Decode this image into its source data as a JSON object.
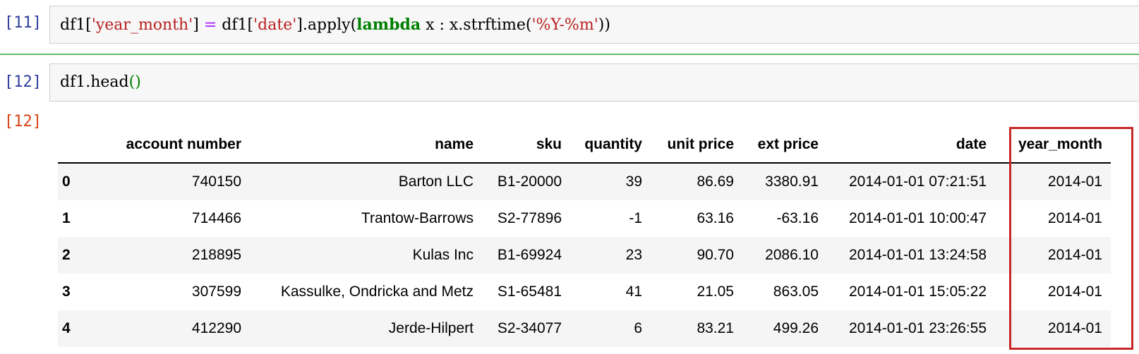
{
  "cells": [
    {
      "prompt": "[11]",
      "code": {
        "t1": "df1[",
        "s1": "'year_month'",
        "t2": "] ",
        "op": "=",
        "t3": " df1[",
        "s2": "'date'",
        "t4": "].apply(",
        "kw": "lambda",
        "t5": " x : x.strftime(",
        "s3": "'%Y-%m'",
        "t6": "))"
      }
    },
    {
      "prompt": "[12]",
      "code": {
        "t1": "df1.head",
        "paren": "()"
      }
    }
  ],
  "output_prompt": "[12]",
  "table": {
    "columns": [
      "",
      "account number",
      "name",
      "sku",
      "quantity",
      "unit price",
      "ext price",
      "date",
      "year_month"
    ],
    "rows": [
      [
        "0",
        "740150",
        "Barton LLC",
        "B1-20000",
        "39",
        "86.69",
        "3380.91",
        "2014-01-01 07:21:51",
        "2014-01"
      ],
      [
        "1",
        "714466",
        "Trantow-Barrows",
        "S2-77896",
        "-1",
        "63.16",
        "-63.16",
        "2014-01-01 10:00:47",
        "2014-01"
      ],
      [
        "2",
        "218895",
        "Kulas Inc",
        "B1-69924",
        "23",
        "90.70",
        "2086.10",
        "2014-01-01 13:24:58",
        "2014-01"
      ],
      [
        "3",
        "307599",
        "Kassulke, Ondricka and Metz",
        "S1-65481",
        "41",
        "21.05",
        "863.05",
        "2014-01-01 15:05:22",
        "2014-01"
      ],
      [
        "4",
        "412290",
        "Jerde-Hilpert",
        "S2-34077",
        "6",
        "83.21",
        "499.26",
        "2014-01-01 23:26:55",
        "2014-01"
      ]
    ]
  },
  "colors": {
    "prompt_in": "#303f9f",
    "prompt_out": "#d84315",
    "string": "#ba2121",
    "keyword": "#008000",
    "highlight_box": "#c62828",
    "cell_separator": "#66bb6a"
  }
}
